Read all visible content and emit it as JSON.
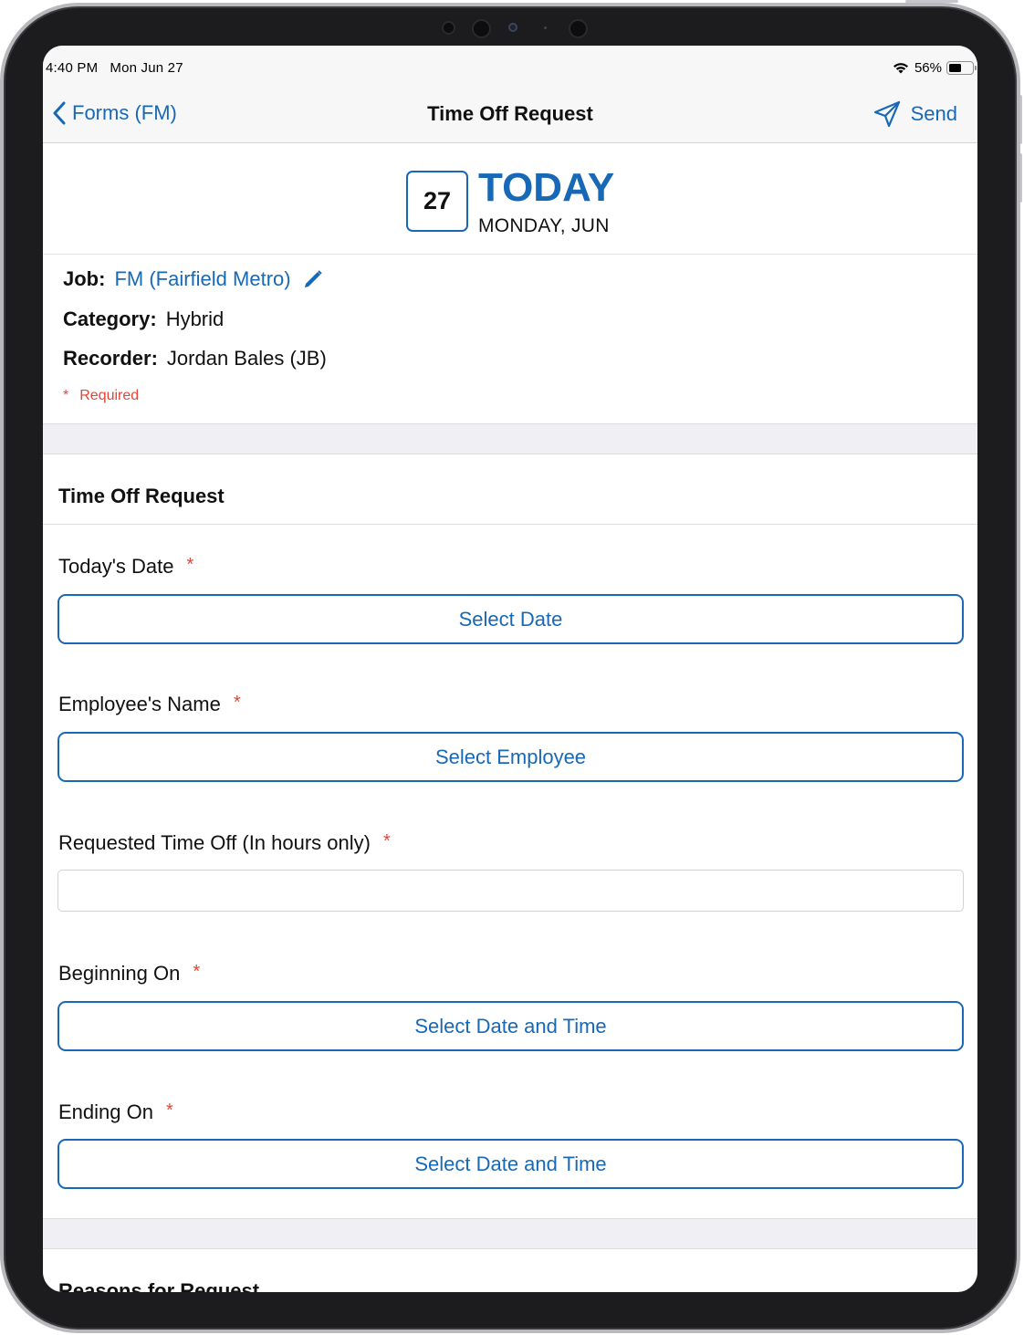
{
  "status_bar": {
    "time": "4:40 PM",
    "date": "Mon Jun 27",
    "battery": "56%",
    "battery_level": 0.56
  },
  "nav": {
    "back_label": "Forms (FM)",
    "title": "Time Off Request",
    "send_label": "Send"
  },
  "date_header": {
    "day_number": "27",
    "today_label": "TODAY",
    "weekday_label": "MONDAY, JUN"
  },
  "info": {
    "job_label": "Job:",
    "job_value": "FM (Fairfield Metro)",
    "category_label": "Category:",
    "category_value": "Hybrid",
    "recorder_label": "Recorder:",
    "recorder_value": "Jordan Bales (JB)",
    "required_star": "*",
    "required_text": "Required"
  },
  "section1": {
    "title": "Time Off Request"
  },
  "fields": {
    "todays_date": {
      "label": "Today's Date",
      "star": "*",
      "button": "Select Date"
    },
    "employee_name": {
      "label": "Employee's Name",
      "star": "*",
      "button": "Select Employee"
    },
    "requested_time": {
      "label": "Requested Time Off (In hours only)",
      "star": "*",
      "value": ""
    },
    "beginning_on": {
      "label": "Beginning On",
      "star": "*",
      "button": "Select Date and Time"
    },
    "ending_on": {
      "label": "Ending On",
      "star": "*",
      "button": "Select Date and Time"
    }
  },
  "section2": {
    "title": "Reasons for Request"
  },
  "colors": {
    "accent": "#1769b8",
    "required": "#e4453a",
    "band": "#efeff4"
  }
}
